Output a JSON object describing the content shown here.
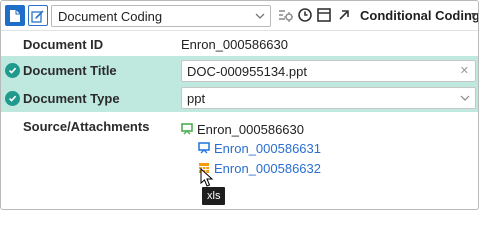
{
  "toolbar": {
    "layout_select": "Document Coding",
    "conditional_label": "Conditional Coding"
  },
  "fields": {
    "document_id": {
      "label": "Document ID",
      "value": "Enron_000586630"
    },
    "document_title": {
      "label": "Document Title",
      "value": "DOC-000955134.ppt"
    },
    "document_type": {
      "label": "Document Type",
      "value": "ppt"
    },
    "source_attachments": {
      "label": "Source/Attachments"
    }
  },
  "tree": {
    "root": {
      "label": "Enron_000586630",
      "icon": "presentation-icon-green"
    },
    "children": [
      {
        "label": "Enron_000586631",
        "icon": "presentation-icon-blue"
      },
      {
        "label": "Enron_000586632",
        "icon": "spreadsheet-icon-orange"
      }
    ]
  },
  "tooltip": {
    "text": "xls"
  },
  "colors": {
    "accent": "#1f6fc9",
    "highlight_row": "#bfe8df",
    "check": "#1f9a8c",
    "link": "#2a6fd0"
  }
}
